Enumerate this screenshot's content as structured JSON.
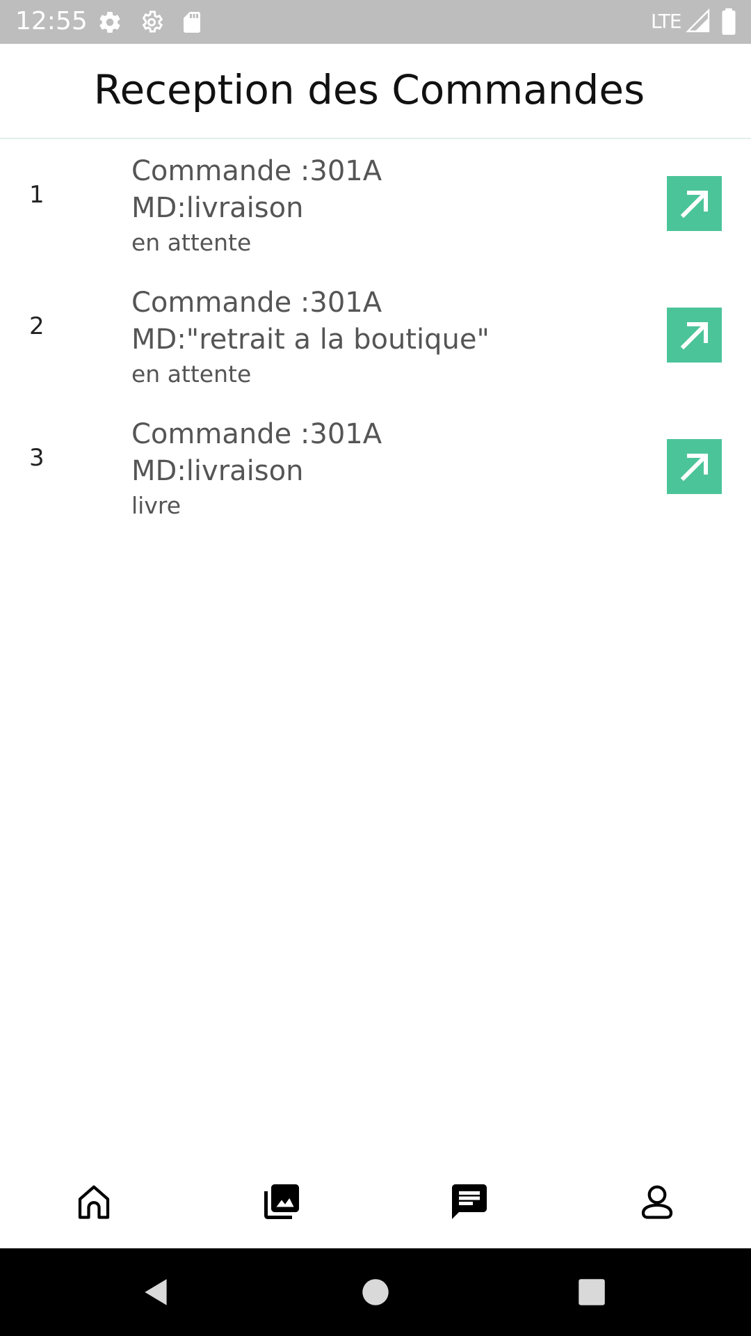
{
  "status_bar": {
    "time": "12:55",
    "network": "LTE",
    "icons": [
      "gear-icon",
      "settings-icon",
      "sd-card-icon",
      "signal-icon",
      "battery-icon"
    ]
  },
  "header": {
    "title": "Reception des Commandes"
  },
  "orders": [
    {
      "index": "1",
      "title": "Commande :301A",
      "mode": "MD:livraison",
      "status": "en attente"
    },
    {
      "index": "2",
      "title": "Commande :301A",
      "mode": "MD:\"retrait a la boutique\"",
      "status": "en attente"
    },
    {
      "index": "3",
      "title": "Commande :301A",
      "mode": "MD:livraison",
      "status": "livre"
    }
  ],
  "bottom_nav": {
    "items": [
      "home-icon",
      "gallery-icon",
      "messages-icon",
      "profile-icon"
    ],
    "active": "messages-icon"
  },
  "colors": {
    "accent": "#4cc49a",
    "status_bar": "#bdbdbd",
    "text_primary": "#111111",
    "text_secondary": "#555555"
  }
}
